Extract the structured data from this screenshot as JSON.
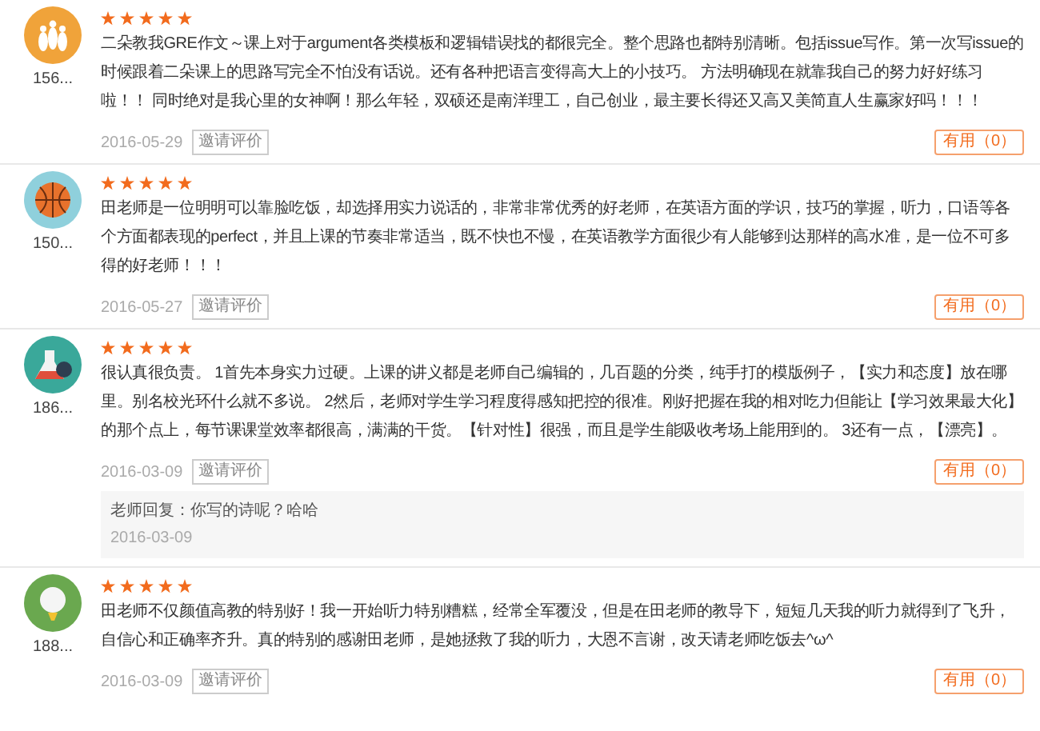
{
  "reviews": [
    {
      "kind": "bowling",
      "user": "156...",
      "stars": 5,
      "text": "二朵教我GRE作文～课上对于argument各类模板和逻辑错误找的都很完全。整个思路也都特别清晰。包括issue写作。第一次写issue的时候跟着二朵课上的思路写完全不怕没有话说。还有各种把语言变得高大上的小技巧。 方法明确现在就靠我自己的努力好好练习啦！！ 同时绝对是我心里的女神啊！那么年轻，双硕还是南洋理工，自己创业，最主要长得还又高又美简直人生赢家好吗！！！",
      "date": "2016-05-29",
      "invite": "邀请评价",
      "useful": "有用（0）"
    },
    {
      "kind": "basketball",
      "user": "150...",
      "stars": 5,
      "text": "田老师是一位明明可以靠脸吃饭，却选择用实力说话的，非常非常优秀的好老师，在英语方面的学识，技巧的掌握，听力，口语等各个方面都表现的perfect，并且上课的节奏非常适当，既不快也不慢，在英语教学方面很少有人能够到达那样的高水准，是一位不可多得的好老师！！！",
      "date": "2016-05-27",
      "invite": "邀请评价",
      "useful": "有用（0）"
    },
    {
      "kind": "flask",
      "user": "186...",
      "stars": 5,
      "text": "很认真很负责。 1首先本身实力过硬。上课的讲义都是老师自己编辑的，几百题的分类，纯手打的模版例子，【实力和态度】放在哪里。别名校光环什么就不多说。 2然后，老师对学生学习程度得感知把控的很准。刚好把握在我的相对吃力但能让【学习效果最大化】的那个点上，每节课课堂效率都很高，满满的干货。【针对性】很强，而且是学生能吸收考场上能用到的。 3还有一点，【漂亮】。",
      "date": "2016-03-09",
      "invite": "邀请评价",
      "useful": "有用（0）",
      "reply": {
        "text": "老师回复：你写的诗呢？哈哈",
        "date": "2016-03-09"
      }
    },
    {
      "kind": "golf",
      "user": "188...",
      "stars": 5,
      "text": "田老师不仅颜值高教的特别好！我一开始听力特别糟糕，经常全军覆没，但是在田老师的教导下，短短几天我的听力就得到了飞升，自信心和正确率齐升。真的特别的感谢田老师，是她拯救了我的听力，大恩不言谢，改天请老师吃饭去^ω^",
      "date": "2016-03-09",
      "invite": "邀请评价",
      "useful": "有用（0）"
    }
  ]
}
